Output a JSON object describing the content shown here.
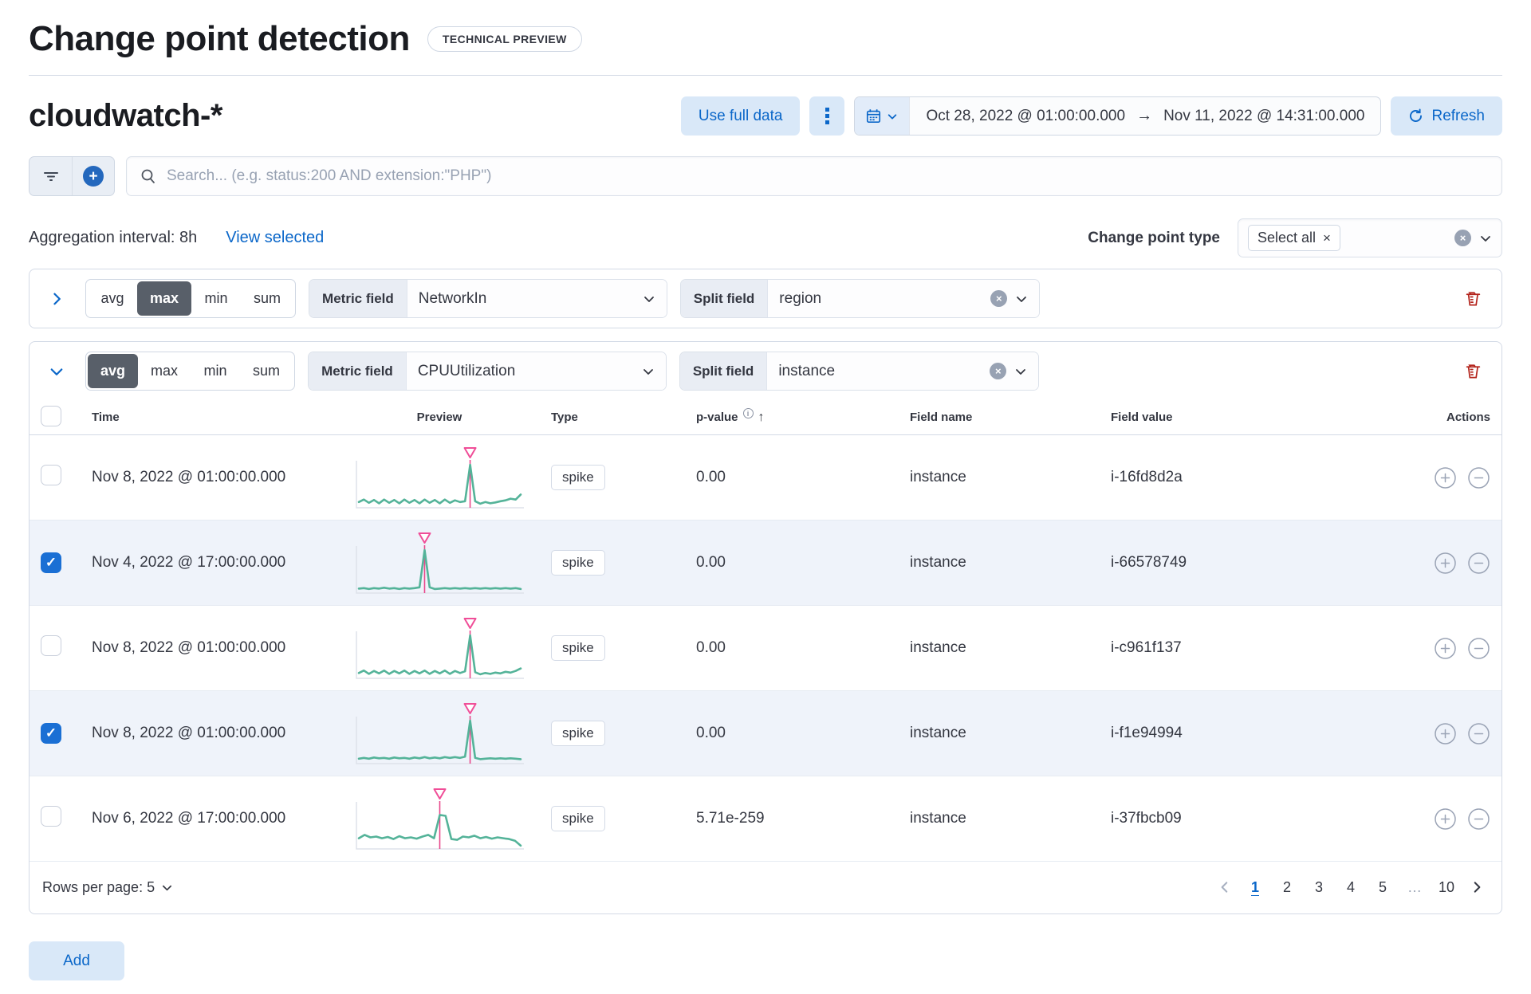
{
  "page": {
    "title": "Change point detection",
    "badge": "TECHNICAL PREVIEW"
  },
  "header": {
    "index_pattern": "cloudwatch-*",
    "use_full_data_label": "Use full data",
    "date_range": {
      "start": "Oct 28, 2022 @ 01:00:00.000",
      "end": "Nov 11, 2022 @ 14:31:00.000"
    },
    "refresh_label": "Refresh"
  },
  "search": {
    "placeholder": "Search... (e.g. status:200 AND extension:\"PHP\")"
  },
  "controls": {
    "aggregation_interval": "Aggregation interval: 8h",
    "view_selected": "View selected",
    "change_point_type_label": "Change point type",
    "change_point_type_value": "Select all"
  },
  "configs": [
    {
      "fn_options": [
        "avg",
        "max",
        "min",
        "sum"
      ],
      "selected_fn": "max",
      "metric_label": "Metric field",
      "metric_value": "NetworkIn",
      "split_label": "Split field",
      "split_value": "region"
    },
    {
      "fn_options": [
        "avg",
        "max",
        "min",
        "sum"
      ],
      "selected_fn": "avg",
      "metric_label": "Metric field",
      "metric_value": "CPUUtilization",
      "split_label": "Split field",
      "split_value": "instance"
    }
  ],
  "table": {
    "columns": {
      "time": "Time",
      "preview": "Preview",
      "type": "Type",
      "pvalue": "p-value",
      "field_name": "Field name",
      "field_value": "Field value",
      "actions": "Actions"
    },
    "rows": [
      {
        "time": "Nov 8, 2022 @ 01:00:00.000",
        "type": "spike",
        "p_value": "0.00",
        "field_name": "instance",
        "field_value": "i-16fd8d2a",
        "selected": false,
        "spark": {
          "cp": 22,
          "values": [
            0.1,
            0.16,
            0.08,
            0.15,
            0.07,
            0.16,
            0.08,
            0.15,
            0.07,
            0.16,
            0.08,
            0.15,
            0.07,
            0.16,
            0.08,
            0.15,
            0.07,
            0.16,
            0.08,
            0.14,
            0.1,
            0.12,
            1.0,
            0.12,
            0.06,
            0.1,
            0.07,
            0.09,
            0.12,
            0.14,
            0.18,
            0.16,
            0.28
          ]
        }
      },
      {
        "time": "Nov 4, 2022 @ 17:00:00.000",
        "type": "spike",
        "p_value": "0.00",
        "field_name": "instance",
        "field_value": "i-66578749",
        "selected": true,
        "spark": {
          "cp": 13,
          "values": [
            0.07,
            0.08,
            0.06,
            0.08,
            0.07,
            0.09,
            0.07,
            0.08,
            0.06,
            0.08,
            0.07,
            0.08,
            0.1,
            1.0,
            0.1,
            0.06,
            0.07,
            0.08,
            0.07,
            0.08,
            0.07,
            0.08,
            0.07,
            0.08,
            0.07,
            0.08,
            0.07,
            0.08,
            0.07,
            0.08,
            0.07,
            0.08,
            0.06
          ]
        }
      },
      {
        "time": "Nov 8, 2022 @ 01:00:00.000",
        "type": "spike",
        "p_value": "0.00",
        "field_name": "instance",
        "field_value": "i-c961f137",
        "selected": false,
        "spark": {
          "cp": 22,
          "values": [
            0.09,
            0.15,
            0.07,
            0.14,
            0.08,
            0.15,
            0.07,
            0.14,
            0.08,
            0.15,
            0.07,
            0.14,
            0.08,
            0.15,
            0.07,
            0.14,
            0.08,
            0.15,
            0.07,
            0.14,
            0.09,
            0.13,
            1.0,
            0.11,
            0.06,
            0.09,
            0.07,
            0.1,
            0.08,
            0.12,
            0.1,
            0.14,
            0.2
          ]
        }
      },
      {
        "time": "Nov 8, 2022 @ 01:00:00.000",
        "type": "spike",
        "p_value": "0.00",
        "field_name": "instance",
        "field_value": "i-f1e94994",
        "selected": true,
        "spark": {
          "cp": 22,
          "values": [
            0.08,
            0.1,
            0.08,
            0.11,
            0.09,
            0.1,
            0.08,
            0.11,
            0.09,
            0.1,
            0.08,
            0.11,
            0.09,
            0.12,
            0.09,
            0.11,
            0.09,
            0.12,
            0.1,
            0.12,
            0.1,
            0.13,
            1.0,
            0.1,
            0.07,
            0.08,
            0.09,
            0.08,
            0.09,
            0.08,
            0.09,
            0.08,
            0.07
          ]
        }
      },
      {
        "time": "Nov 6, 2022 @ 17:00:00.000",
        "type": "spike",
        "p_value": "5.71e-259",
        "field_name": "instance",
        "field_value": "i-37fbcb09",
        "selected": false,
        "spark": {
          "cp": 14,
          "values": [
            0.22,
            0.3,
            0.24,
            0.26,
            0.22,
            0.25,
            0.2,
            0.27,
            0.22,
            0.24,
            0.21,
            0.26,
            0.3,
            0.22,
            0.78,
            0.76,
            0.2,
            0.18,
            0.26,
            0.24,
            0.28,
            0.22,
            0.25,
            0.21,
            0.24,
            0.22,
            0.2,
            0.16,
            0.04
          ]
        }
      }
    ]
  },
  "pagination": {
    "rows_per_page": "Rows per page: 5",
    "pages": [
      "1",
      "2",
      "3",
      "4",
      "5",
      "…",
      "10"
    ],
    "active_page": "1"
  },
  "footer": {
    "add_label": "Add"
  },
  "colors": {
    "accent_blue": "#0b67c9",
    "light_blue_fill": "#d9e8f8",
    "spark_green": "#54b399",
    "change_point_pink": "#f04e98",
    "trash_red": "#b4251d",
    "selected_row_bg": "#eff3fa"
  }
}
